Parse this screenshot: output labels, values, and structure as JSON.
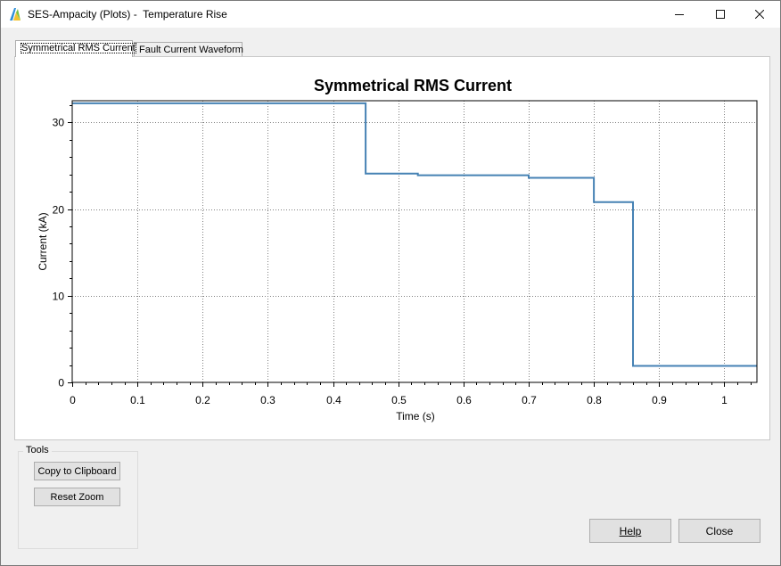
{
  "window": {
    "title": "SES-Ampacity (Plots) -  Temperature Rise",
    "icon": "ses-app-icon",
    "controls": [
      "minimize-icon",
      "maximize-icon",
      "close-icon"
    ]
  },
  "tabs": [
    {
      "label": "Symmetrical RMS Current",
      "active": true
    },
    {
      "label": "Fault Current Waveform",
      "active": false
    }
  ],
  "tools": {
    "group_label": "Tools",
    "copy_label": "Copy to Clipboard",
    "reset_label": "Reset Zoom"
  },
  "footer": {
    "help_label": "Help",
    "close_label": "Close"
  },
  "colors": {
    "series": "#4682b4",
    "grid": "#808080"
  },
  "chart_data": {
    "type": "line",
    "title": "Symmetrical RMS Current",
    "xlabel": "Time (s)",
    "ylabel": "Current (kA)",
    "xlim": [
      0,
      1.05
    ],
    "ylim": [
      0,
      32.5
    ],
    "xticks": [
      0,
      0.1,
      0.2,
      0.3,
      0.4,
      0.5,
      0.6,
      0.7,
      0.8,
      0.9,
      1
    ],
    "xtick_labels": [
      "0",
      "0.1",
      "0.2",
      "0.3",
      "0.4",
      "0.5",
      "0.6",
      "0.7",
      "0.8",
      "0.9",
      "1"
    ],
    "yticks": [
      0,
      10,
      20,
      30
    ],
    "ytick_labels": [
      "0",
      "10",
      "20",
      "30"
    ],
    "grid": true,
    "series": [
      {
        "points": [
          [
            0,
            32.2
          ],
          [
            0.45,
            32.2
          ],
          [
            0.45,
            24.1
          ],
          [
            0.53,
            24.1
          ],
          [
            0.53,
            23.9
          ],
          [
            0.7,
            23.9
          ],
          [
            0.7,
            23.6
          ],
          [
            0.8,
            23.6
          ],
          [
            0.8,
            20.8
          ],
          [
            0.86,
            20.8
          ],
          [
            0.86,
            1.9
          ],
          [
            1.05,
            1.9
          ]
        ]
      }
    ]
  }
}
